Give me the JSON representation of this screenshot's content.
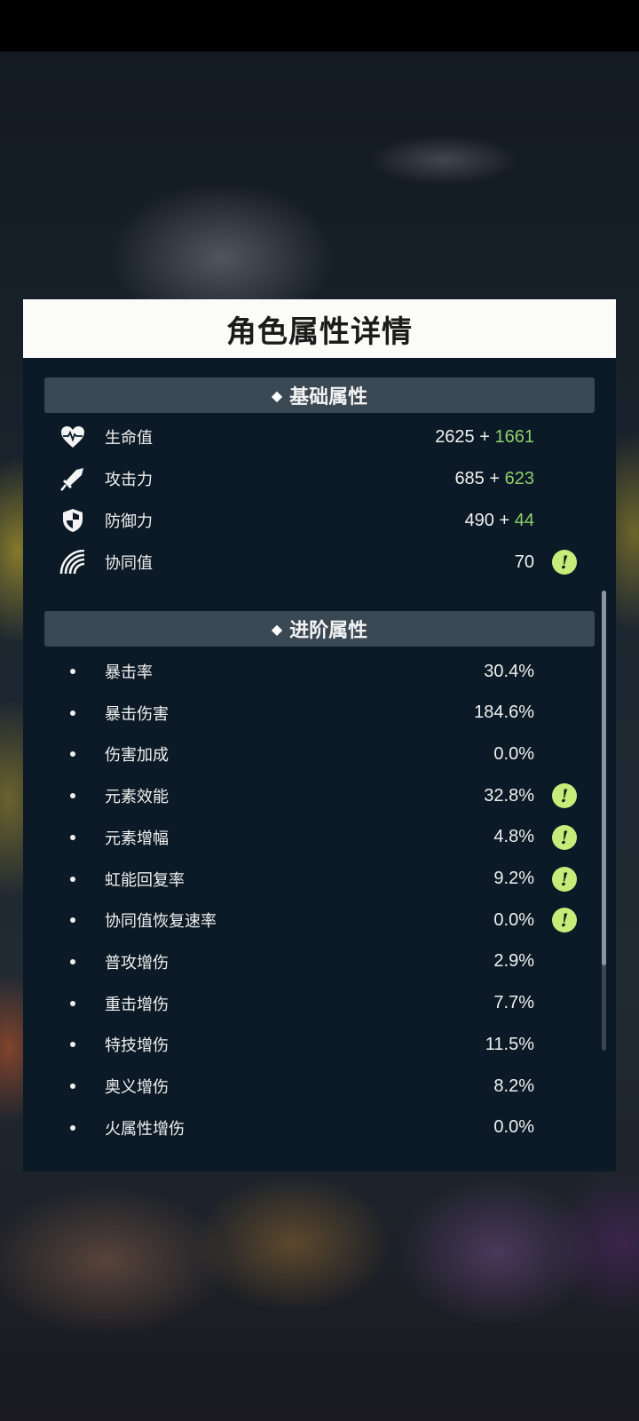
{
  "panel": {
    "title": "角色属性详情"
  },
  "basic_section": {
    "title": "基础属性",
    "stats": [
      {
        "icon": "heart-icon",
        "label": "生命值",
        "base": "2625",
        "plus": "+",
        "bonus": "1661",
        "warning": false
      },
      {
        "icon": "sword-icon",
        "label": "攻击力",
        "base": "685",
        "plus": "+",
        "bonus": "623",
        "warning": false
      },
      {
        "icon": "shield-icon",
        "label": "防御力",
        "base": "490",
        "plus": "+",
        "bonus": "44",
        "warning": false
      },
      {
        "icon": "rainbow-icon",
        "label": "协同值",
        "base": "70",
        "plus": "",
        "bonus": "",
        "warning": true
      }
    ]
  },
  "advanced_section": {
    "title": "进阶属性",
    "stats": [
      {
        "label": "暴击率",
        "value": "30.4%",
        "warning": false
      },
      {
        "label": "暴击伤害",
        "value": "184.6%",
        "warning": false
      },
      {
        "label": "伤害加成",
        "value": "0.0%",
        "warning": false
      },
      {
        "label": "元素效能",
        "value": "32.8%",
        "warning": true
      },
      {
        "label": "元素增幅",
        "value": "4.8%",
        "warning": true
      },
      {
        "label": "虹能回复率",
        "value": "9.2%",
        "warning": true
      },
      {
        "label": "协同值恢复速率",
        "value": "0.0%",
        "warning": true
      },
      {
        "label": "普攻增伤",
        "value": "2.9%",
        "warning": false
      },
      {
        "label": "重击增伤",
        "value": "7.7%",
        "warning": false
      },
      {
        "label": "特技增伤",
        "value": "11.5%",
        "warning": false
      },
      {
        "label": "奥义增伤",
        "value": "8.2%",
        "warning": false
      },
      {
        "label": "火属性增伤",
        "value": "0.0%",
        "warning": false
      }
    ]
  },
  "warning_glyph": "!",
  "section_marker": "⟐",
  "colors": {
    "panel_bg": "#0b1a26",
    "header_bg": "#fbfbf8",
    "section_bg": "#3a4853",
    "bonus_green": "#8ecf6c",
    "warning_badge": "#c6ec7a"
  }
}
